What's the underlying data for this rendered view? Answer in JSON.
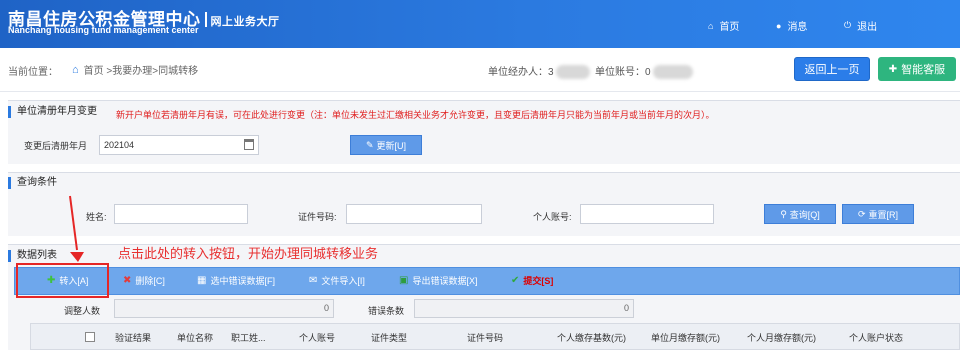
{
  "header": {
    "title_cn": "南昌住房公积金管理中心",
    "subtitle": "网上业务大厅",
    "title_en": "Nanchang housing fund management center",
    "nav": [
      {
        "label": "首页",
        "icon": "home-icon"
      },
      {
        "label": "消息",
        "icon": "message-icon"
      },
      {
        "label": "退出",
        "icon": "power-icon"
      }
    ]
  },
  "breadcrumb": {
    "label": "当前位置：",
    "path": "首页 >我要办理>同城转移"
  },
  "user_info": {
    "agent_label": "单位经办人：",
    "agent_value_prefix": "3",
    "account_label": "单位账号：",
    "account_value_prefix": "0"
  },
  "actions": {
    "back": "返回上一页",
    "service": "智能客服"
  },
  "change_section": {
    "title": "单位清册年月变更",
    "notice": "新开户单位若清册年月有误，可在此处进行变更（注：单位未发生过汇缴相关业务才允许变更，且变更后清册年月只能为当前年月或当前年月的次月）。",
    "field_label": "变更后清册年月",
    "field_value": "202104",
    "update_button": "更新[U]"
  },
  "query_section": {
    "title": "查询条件",
    "name_label": "姓名:",
    "id_label": "证件号码:",
    "account_label": "个人账号:",
    "query_button": "查询[Q]",
    "reset_button": "重置[R]"
  },
  "data_section": {
    "title": "数据列表",
    "annotation": "点击此处的转入按钮，开始办理同城转移业务"
  },
  "toolbar": {
    "transfer_in": "转入[A]",
    "delete": "删除[C]",
    "select_errors": "选中错误数据[F]",
    "import_file": "文件导入[I]",
    "export_errors": "导出错误数据[X]",
    "submit": "提交[S]"
  },
  "stats": {
    "adjust_label": "调整人数",
    "adjust_value": "0",
    "error_label": "错误条数",
    "error_value": "0"
  },
  "table": {
    "columns": [
      "验证结果",
      "单位名称",
      "职工姓...",
      "个人账号",
      "证件类型",
      "证件号码",
      "个人缴存基数(元)",
      "单位月缴存额(元)",
      "个人月缴存额(元)",
      "个人账户状态"
    ]
  },
  "colors": {
    "header_blue": "#2b7ae0",
    "toolbar_blue": "#6ea7ec",
    "service_green": "#2eb57f",
    "annotation_red": "#e83030"
  }
}
